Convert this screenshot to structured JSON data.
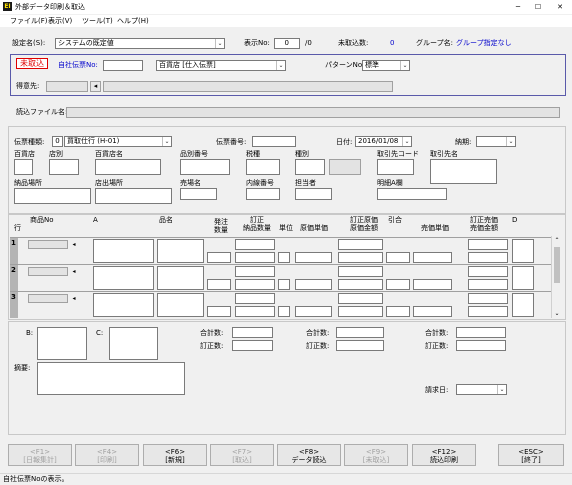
{
  "window": {
    "title": "外部データ印刷＆取込",
    "icon_text": "EI",
    "minimize": "─",
    "maximize": "☐",
    "close": "✕"
  },
  "menu": [
    "ファイル(F)",
    "表示(V)",
    "ツール(T)",
    "ヘルプ(H)"
  ],
  "top": {
    "setting_label": "設定名(S):",
    "setting_value": "システムの既定値",
    "display_no_label": "表示No:",
    "display_no_value": "0",
    "display_total": "/0",
    "untaken_label": "未取込数:",
    "untaken_value": "0",
    "group_label": "グループ名:",
    "group_value": "グループ指定なし"
  },
  "header_panel": {
    "badge": "未取込",
    "own_no_label": "自社伝票No:",
    "store_value": "百貨店 [仕入伝票]",
    "pattern_label": "パターンNo:",
    "pattern_value": "標準",
    "customer_label": "得意先:"
  },
  "file": {
    "label": "読込ファイル名:"
  },
  "form": {
    "slip_type_label": "伝票種類:",
    "slip_type_code": "0",
    "slip_type_value": "買取仕行 (H-01)",
    "slip_no_label": "伝票番号:",
    "date_label": "日付:",
    "date_value": "2016/01/08",
    "delivery_label": "納期:",
    "dept_store": "百貨店",
    "store": "店別",
    "dept_store_name": "百貨店名",
    "item_no": "品別番号",
    "tax": "税種",
    "kind": "種別",
    "dest_code": "取引先コード",
    "dest_name": "取引先名",
    "delivery_place": "納品場所",
    "shop_place": "店出場所",
    "sales_name": "売場名",
    "internal_no": "内線番号",
    "person": "担当者",
    "detail_a": "明細A欄"
  },
  "grid": {
    "headers": {
      "row": "行",
      "product_no": "商品No",
      "a": "A",
      "name": "品名",
      "order_qty": "発注\n数量",
      "corr_delivery": "訂正\n納品数量",
      "unit": "単位",
      "cost_unit": "原価単価",
      "corr_cost_unit": "訂正原価\n原価金額",
      "discount": "引合",
      "sales_unit": "売価単価",
      "corr_sales": "訂正売価\n売価金額",
      "d": "D"
    },
    "rows": [
      "1",
      "2",
      "3"
    ]
  },
  "totals": {
    "b": "B:",
    "c": "C:",
    "sum_label": "合計数:",
    "corr_label": "訂正数:",
    "memo_label": "摘要:",
    "invoice_label": "請求日:"
  },
  "buttons": [
    {
      "key": "<F1>",
      "label": "[日報集計]",
      "enabled": false
    },
    {
      "key": "<F4>",
      "label": "[印刷]",
      "enabled": false
    },
    {
      "key": "<F6>",
      "label": "[新規]",
      "enabled": true
    },
    {
      "key": "<F7>",
      "label": "[取込]",
      "enabled": false
    },
    {
      "key": "<F8>",
      "label": "データ読込",
      "enabled": true
    },
    {
      "key": "<F9>",
      "label": "[未取込]",
      "enabled": false
    },
    {
      "key": "<F12>",
      "label": "読込印刷",
      "enabled": true
    },
    {
      "key": "<ESC>",
      "label": "[終了]",
      "enabled": true
    }
  ],
  "status": {
    "text": "自社伝票Noの表示。"
  },
  "colors": {
    "accent_blue": "#0000cc",
    "red": "#e00000",
    "panel_border": "#5a5aaa",
    "row_header": "#b4b4b4"
  }
}
